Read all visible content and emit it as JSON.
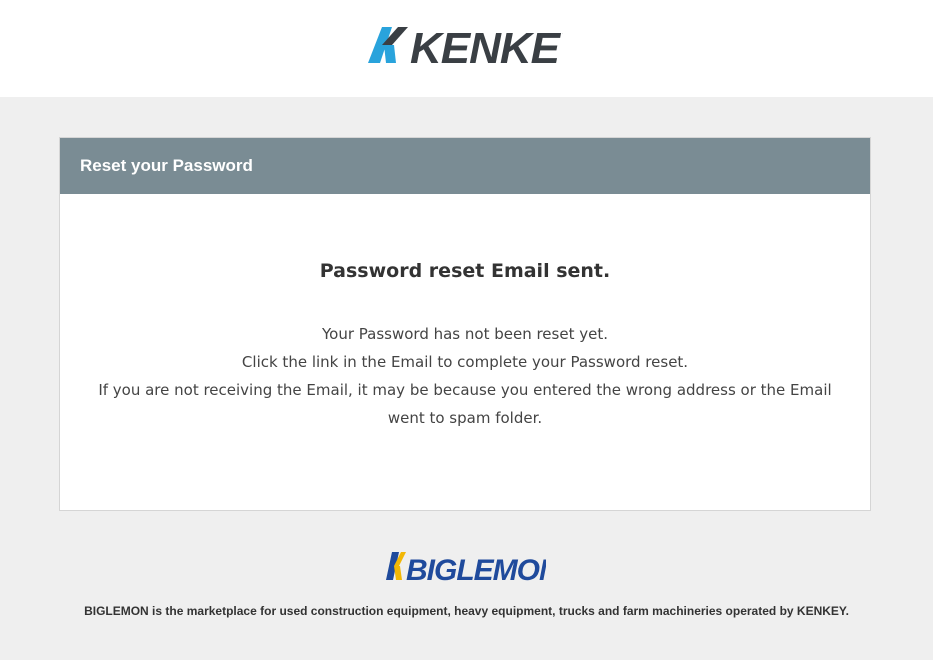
{
  "header": {
    "logo_text": "KENKEY"
  },
  "card": {
    "header_title": "Reset your Password",
    "title": "Password reset Email sent.",
    "lines": [
      "Your Password has not been reset yet.",
      "Click the link in the Email to complete your Password reset.",
      "If you are not receiving the Email, it may be because you entered the wrong address or the Email",
      "went to spam folder."
    ]
  },
  "footer": {
    "logo_text": "BIGLEMON",
    "description": "BIGLEMON is the marketplace for used construction equipment, heavy equipment, trucks and farm machineries operated by KENKEY."
  },
  "colors": {
    "kenkey_blue": "#29a3dc",
    "kenkey_dark": "#3a3f44",
    "card_header": "#7a8c94",
    "biglemon_blue": "#1f4a9c",
    "biglemon_yellow": "#f2b705"
  }
}
